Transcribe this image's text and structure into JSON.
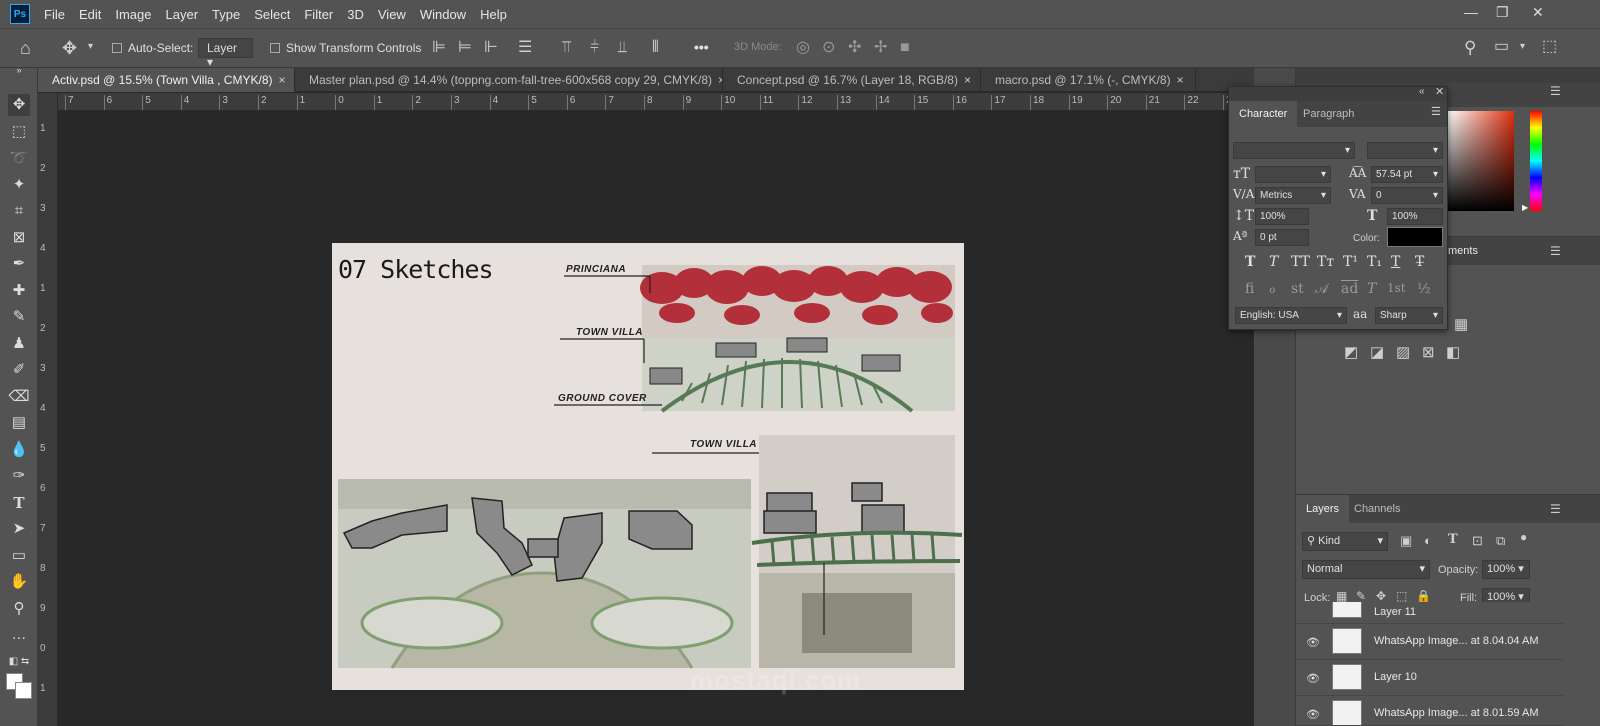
{
  "app": {
    "logo": "Ps"
  },
  "menu": [
    "File",
    "Edit",
    "Image",
    "Layer",
    "Type",
    "Select",
    "Filter",
    "3D",
    "View",
    "Window",
    "Help"
  ],
  "options": {
    "auto_select_label": "Auto-Select:",
    "auto_select_value": "Layer",
    "show_transform_label": "Show Transform Controls",
    "mode_3d_label": "3D Mode:",
    "more_label": "•••"
  },
  "tabs": [
    {
      "label": "Activ.psd @ 15.5% (Town Villa , CMYK/8)",
      "close": "×",
      "active": true
    },
    {
      "label": "Master plan.psd @ 14.4% (toppng.com-fall-tree-600x568 copy 29, CMYK/8)",
      "close": "×",
      "active": false
    },
    {
      "label": "Concept.psd @ 16.7% (Layer 18, RGB/8)",
      "close": "×",
      "active": false
    },
    {
      "label": "macro.psd @ 17.1% (-, CMYK/8)",
      "close": "×",
      "active": false
    }
  ],
  "ruler_h": [
    "7",
    "6",
    "5",
    "4",
    "3",
    "2",
    "1",
    "0",
    "1",
    "2",
    "3",
    "4",
    "5",
    "6",
    "7",
    "8",
    "9",
    "10",
    "11",
    "12",
    "13",
    "14",
    "15",
    "16",
    "17",
    "18",
    "19",
    "20",
    "21",
    "22",
    "23"
  ],
  "ruler_v": [
    "1",
    "2",
    "3",
    "4",
    "1",
    "2",
    "3",
    "4",
    "5",
    "6",
    "7",
    "8",
    "9",
    "0",
    "1"
  ],
  "document": {
    "title": "07  Sketches",
    "labels": [
      "PRINCIANA",
      "TOWN VILLA",
      "GROUND COVER",
      "TOWN VILLA"
    ],
    "watermark": "mostaql.com"
  },
  "character_panel": {
    "tabs": [
      "Character",
      "Paragraph"
    ],
    "leading": "57.54 pt",
    "kerning": "Metrics",
    "tracking": "0",
    "vertical_scale": "100%",
    "horizontal_scale": "100%",
    "baseline_shift": "0 pt",
    "color_label": "Color:",
    "color": "#000000",
    "language": "English: USA",
    "antialias_icon": "aa",
    "antialias": "Sharp",
    "style_glyphs": [
      "T",
      "T",
      "TT",
      "Tт",
      "T¹",
      "T₁",
      "T",
      "T̶"
    ],
    "opentype_glyphs": [
      "fi",
      "ℴ",
      "st",
      "𝒜",
      "ad",
      "T",
      "1st",
      "½"
    ]
  },
  "swatches": {
    "hue_colors": [
      "#ff0000",
      "#ffff00",
      "#00ff00",
      "#00ffff",
      "#0000ff",
      "#ff00ff",
      "#ff0000"
    ],
    "gradient_base": "#e03010"
  },
  "adjust_panel": {
    "tab_partial": "ments"
  },
  "layers_panel": {
    "tabs": [
      "Layers",
      "Channels"
    ],
    "filter_kind": "Kind",
    "blend_mode": "Normal",
    "opacity_label": "Opacity:",
    "opacity": "100%",
    "lock_label": "Lock:",
    "fill_label": "Fill:",
    "fill": "100%",
    "layers": [
      {
        "name": "Layer 11",
        "visible": false
      },
      {
        "name": "WhatsApp Image... at 8.04.04 AM",
        "visible": true
      },
      {
        "name": "Layer 10",
        "visible": true
      },
      {
        "name": "WhatsApp Image... at 8.01.59 AM",
        "visible": true
      }
    ]
  }
}
